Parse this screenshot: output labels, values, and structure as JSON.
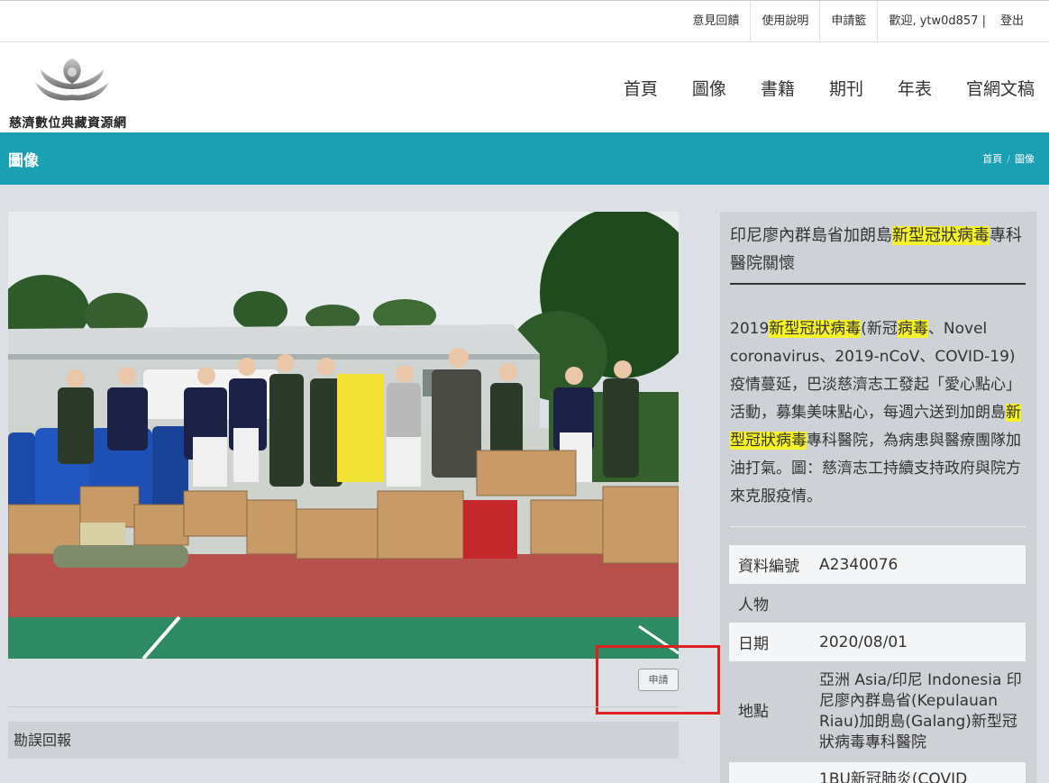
{
  "topbar": {
    "links": [
      "意見回饋",
      "使用說明",
      "申請籃"
    ],
    "welcome": "歡迎, ytw0d857 |",
    "logout": "登出"
  },
  "site": {
    "name": "慈濟數位典藏資源網"
  },
  "nav": [
    "首頁",
    "圖像",
    "書籍",
    "期刊",
    "年表",
    "官網文稿"
  ],
  "section": {
    "title": "圖像",
    "breadcrumb": [
      "首頁",
      "圖像"
    ]
  },
  "photo": {
    "subject": "volunteers and soldiers with donated boxes"
  },
  "apply_label": "申請",
  "report_label": "勘誤回報",
  "record": {
    "title_parts": [
      {
        "t": "印尼廖內群島省加朗島",
        "hl": false
      },
      {
        "t": "新型冠狀病毒",
        "hl": true
      },
      {
        "t": "專科醫院關懷",
        "hl": false
      }
    ],
    "desc_parts": [
      {
        "t": "2019",
        "hl": false
      },
      {
        "t": "新型冠狀病毒",
        "hl": true
      },
      {
        "t": "(新冠",
        "hl": false
      },
      {
        "t": "病毒",
        "hl": true
      },
      {
        "t": "、Novel coronavirus、2019-nCoV、COVID-19)疫情蔓延，巴淡慈濟志工發起「愛心點心」活動，募集美味點心，每週六送到加朗島",
        "hl": false
      },
      {
        "t": "新型冠狀病毒",
        "hl": true
      },
      {
        "t": "專科醫院，為病患與醫療團隊加油打氣。圖：慈濟志工持續支持政府與院方來克服疫情。",
        "hl": false
      }
    ],
    "fields": [
      {
        "label": "資料編號",
        "value": "A2340076"
      },
      {
        "label": "人物",
        "value": ""
      },
      {
        "label": "日期",
        "value": "2020/08/01"
      },
      {
        "label": "地點",
        "value": "亞洲 Asia/印尼 Indonesia 印尼廖內群島省(Kepulauan Riau)加朗島(Galang)新型冠狀病毒專科醫院"
      },
      {
        "label": "",
        "value": "1BU新冠肺炎(COVID"
      }
    ]
  },
  "colors": {
    "accent": "#1a9fb3",
    "highlight": "#f5f227",
    "annotation": "#e02020"
  }
}
